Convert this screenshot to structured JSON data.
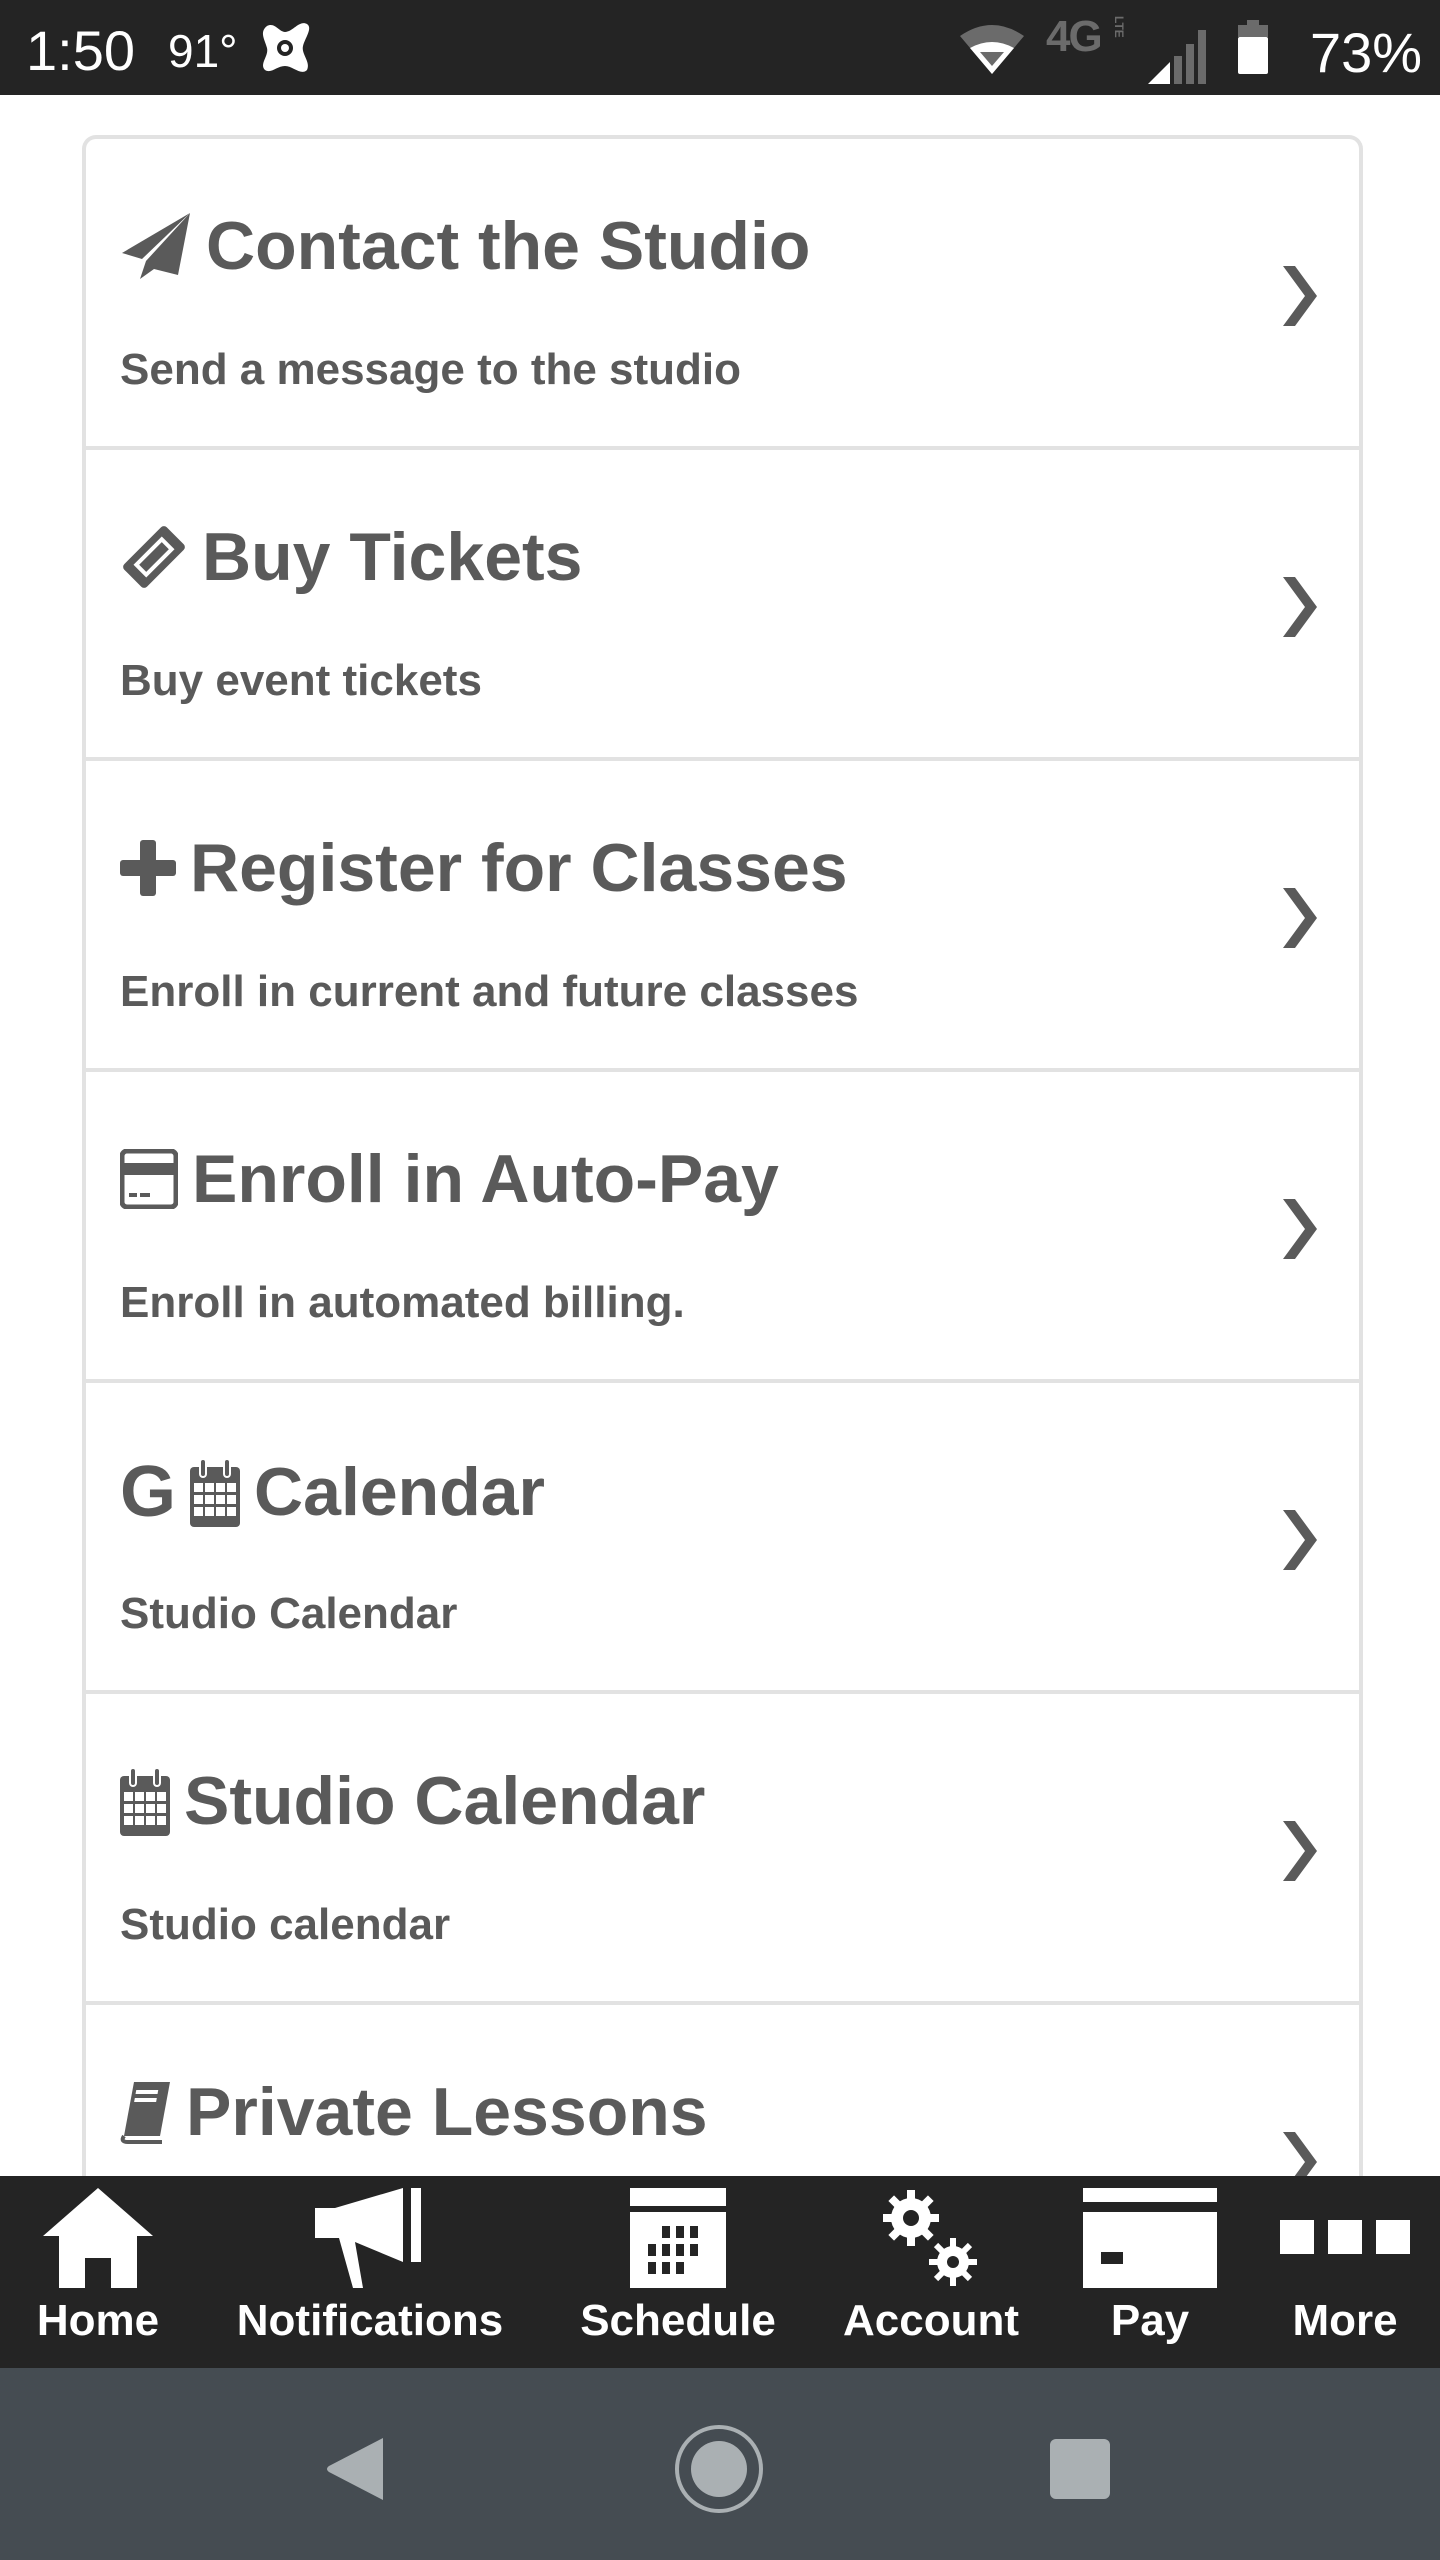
{
  "status_bar": {
    "time": "1:50",
    "temperature": "91°",
    "network": "4G",
    "network_sub": "LTE",
    "battery_percent": "73%"
  },
  "menu_items": [
    {
      "icon": "paper-plane-icon",
      "title": "Contact the Studio",
      "subtitle": "Send a message to the studio"
    },
    {
      "icon": "ticket-icon",
      "title": "Buy Tickets",
      "subtitle": "Buy event tickets"
    },
    {
      "icon": "plus-icon",
      "title": "Register for Classes",
      "subtitle": "Enroll in current and future classes"
    },
    {
      "icon": "credit-card-icon",
      "title": "Enroll in Auto-Pay",
      "subtitle": "Enroll in automated billing."
    },
    {
      "icon": "google-calendar-icon",
      "title": "Calendar",
      "subtitle": "Studio Calendar",
      "prefix": "G"
    },
    {
      "icon": "calendar-icon",
      "title": "Studio Calendar",
      "subtitle": "Studio calendar"
    },
    {
      "icon": "book-icon",
      "title": "Private Lessons",
      "subtitle": ""
    }
  ],
  "tab_bar": {
    "tabs": [
      {
        "label": "Home",
        "icon": "home-icon"
      },
      {
        "label": "Notifications",
        "icon": "megaphone-icon"
      },
      {
        "label": "Schedule",
        "icon": "schedule-icon"
      },
      {
        "label": "Account",
        "icon": "gears-icon"
      },
      {
        "label": "Pay",
        "icon": "credit-card-icon"
      },
      {
        "label": "More",
        "icon": "more-icon"
      }
    ]
  },
  "colors": {
    "text": "#5a5a5a",
    "bar_background": "#242424",
    "nav_background": "#454c52",
    "divider": "#e2e2e2"
  }
}
